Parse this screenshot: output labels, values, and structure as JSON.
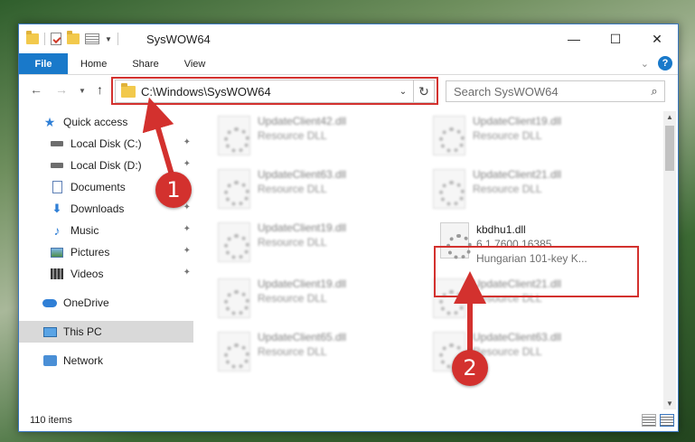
{
  "window": {
    "title": "SysWOW64",
    "controls": {
      "minimize": "—",
      "maximize": "☐",
      "close": "✕"
    }
  },
  "ribbon": {
    "tabs": [
      "File",
      "Home",
      "Share",
      "View"
    ],
    "help": "?"
  },
  "nav": {
    "address": "C:\\Windows\\SysWOW64",
    "search_placeholder": "Search SysWOW64"
  },
  "sidebar": {
    "items": [
      {
        "label": "Quick access",
        "icon": "star-icon",
        "pinned": false
      },
      {
        "label": "Local Disk (C:)",
        "icon": "disk-icon",
        "pinned": true
      },
      {
        "label": "Local Disk (D:)",
        "icon": "disk-icon",
        "pinned": true
      },
      {
        "label": "Documents",
        "icon": "documents-icon",
        "pinned": true
      },
      {
        "label": "Downloads",
        "icon": "download-icon",
        "pinned": true
      },
      {
        "label": "Music",
        "icon": "music-icon",
        "pinned": true
      },
      {
        "label": "Pictures",
        "icon": "pictures-icon",
        "pinned": true
      },
      {
        "label": "Videos",
        "icon": "videos-icon",
        "pinned": true
      },
      {
        "label": "OneDrive",
        "icon": "cloud-icon",
        "pinned": false
      },
      {
        "label": "This PC",
        "icon": "pc-icon",
        "pinned": false,
        "selected": true
      },
      {
        "label": "Network",
        "icon": "network-icon",
        "pinned": false
      }
    ]
  },
  "files": [
    {
      "name": "UpdateClient42.dll",
      "type": "Resource DLL"
    },
    {
      "name": "UpdateClient19.dll",
      "type": "Resource DLL"
    },
    {
      "name": "UpdateClient63.dll",
      "type": "Resource DLL"
    },
    {
      "name": "UpdateClient21.dll",
      "type": "Resource DLL"
    },
    {
      "name": "UpdateClient19.dll",
      "type": "Resource DLL"
    },
    {
      "name": "kbdhu1.dll",
      "type": "6.1.7600.16385",
      "description": "Hungarian 101-key K..."
    },
    {
      "name": "UpdateClient19.dll",
      "type": "Resource DLL"
    },
    {
      "name": "UpdateClient21.dll",
      "type": "Resource DLL"
    },
    {
      "name": "UpdateClient65.dll",
      "type": "Resource DLL"
    },
    {
      "name": "UpdateClient63.dll",
      "type": "Resource DLL"
    }
  ],
  "status": {
    "count": "110 items"
  },
  "annotations": {
    "step1": "1",
    "step2": "2"
  },
  "colors": {
    "accent": "#1979ca",
    "highlight": "#d3312e"
  }
}
